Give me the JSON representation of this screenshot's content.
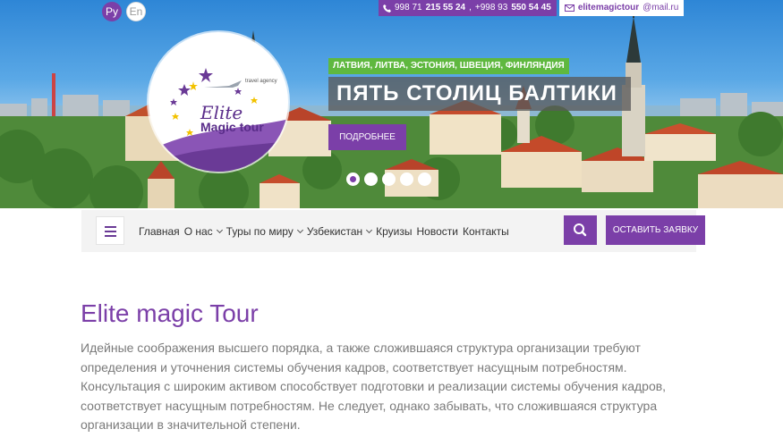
{
  "lang": {
    "ru": "Ру",
    "en": "En",
    "active": "ru"
  },
  "contacts": {
    "phone1_prefix": "998 71",
    "phone1_number": "215 55 24",
    "phone_separator": ",",
    "phone2_prefix": "+998 93",
    "phone2_number": "550 54 45",
    "email_user": "elitemagictour",
    "email_domain": "@mail.ru"
  },
  "logo": {
    "agency": "travel agency",
    "line1": "Elite",
    "line2": "Magic tour"
  },
  "slider": {
    "tagline": "ЛАТВИЯ, ЛИТВА, ЭСТОНИЯ, ШВЕЦИЯ, ФИНЛЯНДИЯ",
    "headline": "ПЯТЬ СТОЛИЦ БАЛТИКИ",
    "button": "ПОДРОБНЕЕ",
    "slide_count": 5,
    "active_slide": 1
  },
  "nav": {
    "items": [
      {
        "label": "Главная"
      },
      {
        "label": "О нас"
      },
      {
        "label": "Туры по миру"
      },
      {
        "label": "Узбекистан"
      },
      {
        "label": "Круизы"
      },
      {
        "label": "Новости"
      },
      {
        "label": "Контакты"
      }
    ],
    "request_button": "ОСТАВИТЬ ЗАЯВКУ"
  },
  "content": {
    "title": "Elite magic Tour",
    "text": "Идейные соображения высшего порядка, а также сложившаяся структура организации требуют определения и уточнения системы обучения кадров, соответствует насущным потребностям. Консультация с широким активом способствует подготовки и реализации системы обучения кадров, соответствует насущным потребностям. Не следует, однако забывать, что сложившаяся структура организации в значительной степени."
  },
  "colors": {
    "accent": "#7b3fa8",
    "tag_green": "#5fb83f"
  },
  "icons": [
    "phone-icon",
    "mail-icon",
    "menu-icon",
    "search-icon",
    "star-icon",
    "chevron-down-icon"
  ]
}
